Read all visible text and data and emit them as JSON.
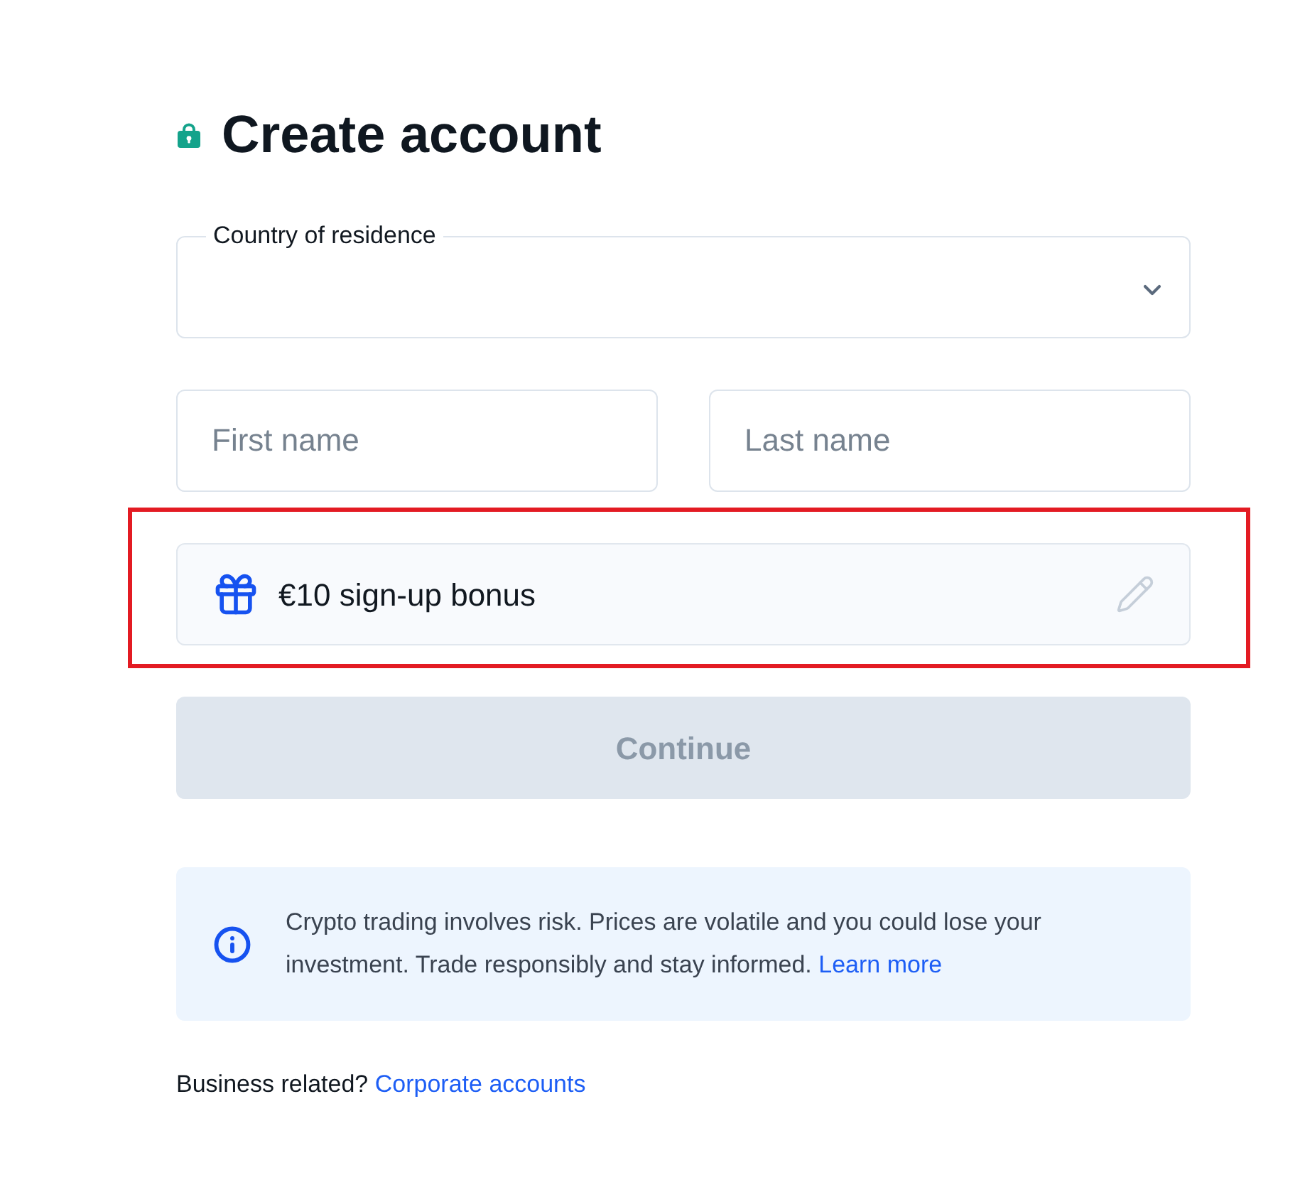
{
  "title": "Create account",
  "country_select": {
    "label": "Country of residence"
  },
  "name_fields": [
    {
      "placeholder": "First name"
    },
    {
      "placeholder": "Last name"
    }
  ],
  "bonus_field": {
    "value": "€10 sign-up bonus",
    "highlighted": true
  },
  "continue_button": {
    "label": "Continue",
    "disabled": true
  },
  "risk_notice": {
    "text": "Crypto trading involves risk. Prices are volatile and you could lose your investment. Trade responsibly and stay informed.",
    "link": "Learn more"
  },
  "footer": {
    "text": "Business related?",
    "link": "Corporate accounts"
  }
}
